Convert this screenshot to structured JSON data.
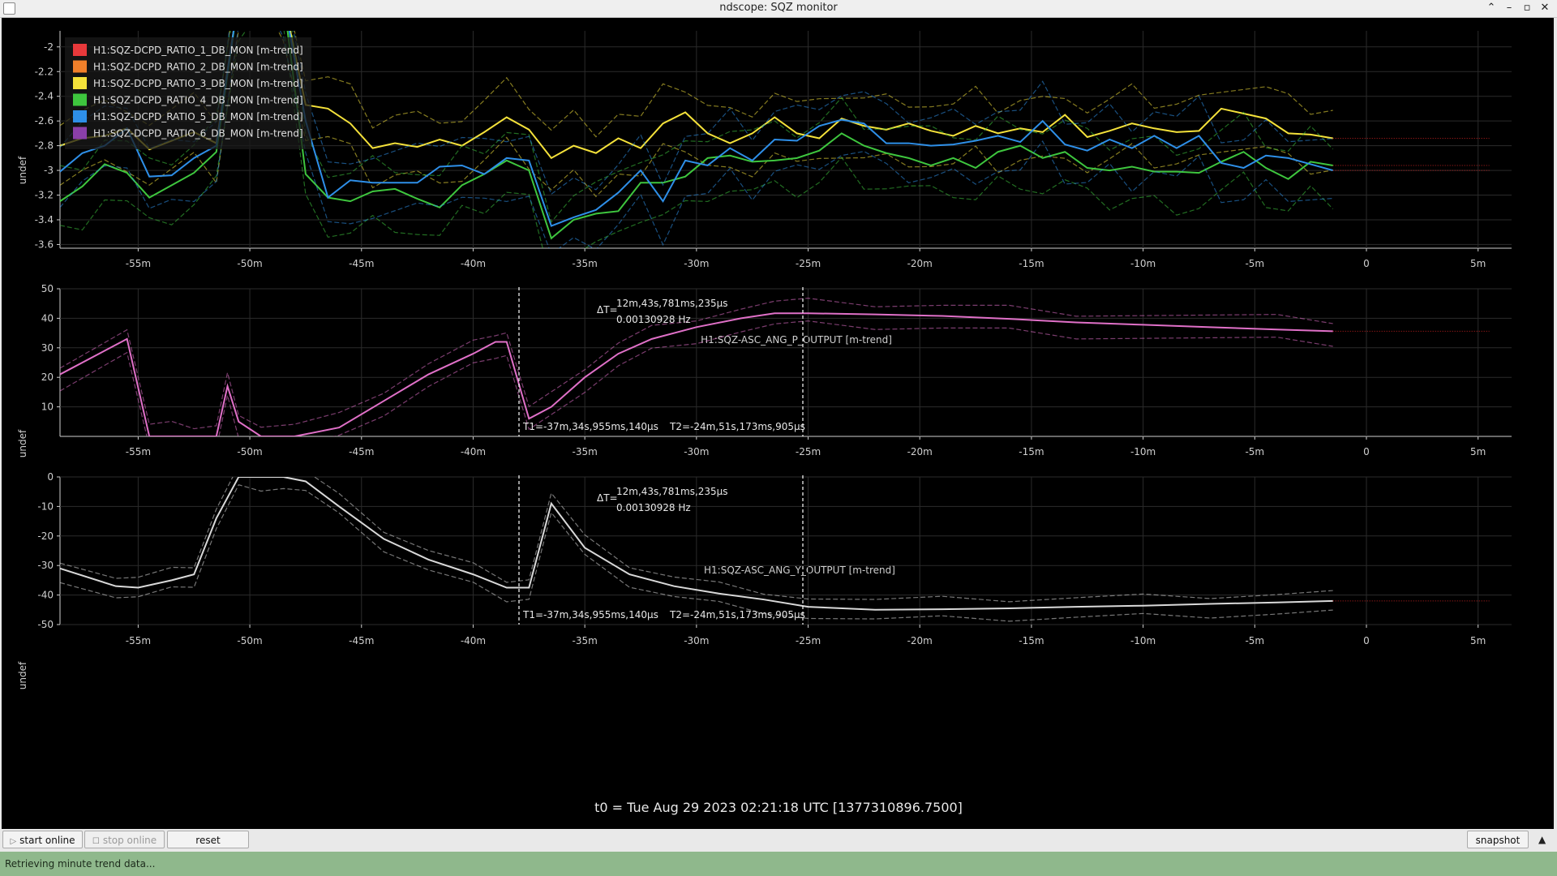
{
  "window": {
    "title": "ndscope: SQZ monitor"
  },
  "colors": {
    "background": "#000000",
    "grid": "#2b2b2b",
    "axis": "#cfcfcf",
    "cursor": "#ffffff",
    "status_bar": "#8fb88c"
  },
  "x_axis": {
    "ticks": [
      "-55m",
      "-50m",
      "-45m",
      "-40m",
      "-35m",
      "-30m",
      "-25m",
      "-20m",
      "-15m",
      "-10m",
      "-5m",
      "0",
      "5m"
    ]
  },
  "cursors": {
    "t1": "T1=-37m,34s,955ms,140μs",
    "t2": "T2=-24m,51s,173ms,905μs",
    "delta_label": "ΔT=",
    "delta": "12m,43s,781ms,235μs",
    "freq": "0.00130928 Hz"
  },
  "t0": "t0 = Tue Aug 29 2023 02:21:18 UTC [1377310896.7500]",
  "controls": {
    "start_online": "start online",
    "stop_online": "stop online",
    "reset": "reset",
    "snapshot": "snapshot"
  },
  "status": "Retrieving minute trend data...",
  "chart_data": [
    {
      "type": "line",
      "title": "",
      "ylabel": "undef",
      "xlabel": "",
      "x_unit": "minutes",
      "xlim": [
        -58.5,
        6.5
      ],
      "ylim": [
        -3.63,
        -1.87
      ],
      "yticks": [
        -2,
        -2.2,
        -2.4,
        -2.6,
        -2.8,
        -3,
        -3.2,
        -3.4,
        -3.6
      ],
      "grid": true,
      "legend_position": "top-left",
      "x": [
        -58.5,
        -57.5,
        -56.5,
        -55.5,
        -54.5,
        -53.5,
        -52.5,
        -51.5,
        -50.5,
        -49.5,
        -48.5,
        -47.5,
        -46.5,
        -45.5,
        -44.5,
        -43.5,
        -42.5,
        -41.5,
        -40.5,
        -39.5,
        -38.5,
        -37.5,
        -36.5,
        -35.5,
        -34.5,
        -33.5,
        -32.5,
        -31.5,
        -30.5,
        -29.5,
        -28.5,
        -27.5,
        -26.5,
        -25.5,
        -24.5,
        -23.5,
        -22.5,
        -21.5,
        -20.5,
        -19.5,
        -18.5,
        -17.5,
        -16.5,
        -15.5,
        -14.5,
        -13.5,
        -12.5,
        -11.5,
        -10.5,
        -9.5,
        -8.5,
        -7.5,
        -6.5,
        -5.5,
        -4.5,
        -3.5,
        -2.5,
        -1.5
      ],
      "series": [
        {
          "name": "H1:SQZ-DCPD_RATIO_1_DB_MON [m-trend]",
          "color": "#e8393b",
          "values": []
        },
        {
          "name": "H1:SQZ-DCPD_RATIO_2_DB_MON [m-trend]",
          "color": "#f07f2a",
          "values": []
        },
        {
          "name": "H1:SQZ-DCPD_RATIO_3_DB_MON [m-trend]",
          "color": "#f4e13a",
          "values": [
            -2.8,
            -2.74,
            -2.72,
            -2.66,
            -2.83,
            -2.76,
            -2.69,
            -2.78,
            -1.6,
            -1.4,
            -1.6,
            -2.47,
            -2.5,
            -2.62,
            -2.82,
            -2.78,
            -2.81,
            -2.75,
            -2.8,
            -2.69,
            -2.57,
            -2.67,
            -2.9,
            -2.8,
            -2.86,
            -2.74,
            -2.82,
            -2.62,
            -2.53,
            -2.7,
            -2.78,
            -2.7,
            -2.57,
            -2.7,
            -2.74,
            -2.58,
            -2.64,
            -2.67,
            -2.62,
            -2.68,
            -2.72,
            -2.64,
            -2.7,
            -2.66,
            -2.69,
            -2.55,
            -2.73,
            -2.68,
            -2.62,
            -2.66,
            -2.69,
            -2.68,
            -2.5,
            -2.54,
            -2.58,
            -2.7,
            -2.71,
            -2.74,
            -2.68,
            -2.58
          ]
        },
        {
          "name": "H1:SQZ-DCPD_RATIO_4_DB_MON [m-trend]",
          "color": "#3ec63e",
          "values": [
            -3.25,
            -3.13,
            -2.95,
            -3.02,
            -3.22,
            -3.12,
            -3.02,
            -2.85,
            -1.6,
            -1.4,
            -1.6,
            -3.03,
            -3.22,
            -3.25,
            -3.17,
            -3.15,
            -3.23,
            -3.3,
            -3.12,
            -3.03,
            -2.92,
            -3.0,
            -3.55,
            -3.4,
            -3.35,
            -3.33,
            -3.1,
            -3.1,
            -3.05,
            -2.9,
            -2.88,
            -2.93,
            -2.92,
            -2.9,
            -2.84,
            -2.7,
            -2.8,
            -2.86,
            -2.9,
            -2.96,
            -2.9,
            -2.98,
            -2.85,
            -2.8,
            -2.9,
            -2.85,
            -2.98,
            -3.0,
            -2.97,
            -3.01,
            -3.01,
            -3.02,
            -2.93,
            -2.85,
            -2.98,
            -3.07,
            -2.93,
            -2.96,
            -2.9,
            -2.85,
            -2.97
          ]
        },
        {
          "name": "H1:SQZ-DCPD_RATIO_5_DB_MON [m-trend]",
          "color": "#2e8fe8",
          "values": [
            -3.01,
            -2.86,
            -2.8,
            -2.66,
            -3.05,
            -3.04,
            -2.9,
            -2.8,
            -1.6,
            -1.4,
            -1.6,
            -2.6,
            -3.22,
            -3.08,
            -3.1,
            -3.1,
            -3.1,
            -2.97,
            -2.96,
            -3.03,
            -2.9,
            -2.92,
            -3.45,
            -3.38,
            -3.32,
            -3.18,
            -3.0,
            -3.25,
            -2.92,
            -2.96,
            -2.82,
            -2.92,
            -2.75,
            -2.76,
            -2.64,
            -2.59,
            -2.62,
            -2.78,
            -2.78,
            -2.8,
            -2.79,
            -2.76,
            -2.72,
            -2.77,
            -2.6,
            -2.79,
            -2.84,
            -2.75,
            -2.82,
            -2.72,
            -2.82,
            -2.72,
            -2.94,
            -2.98,
            -2.88,
            -2.9,
            -2.95,
            -3.0,
            -3.15,
            -2.98,
            -2.88
          ]
        },
        {
          "name": "H1:SQZ-DCPD_RATIO_6_DB_MON [m-trend]",
          "color": "#8a3fa8",
          "values": []
        }
      ]
    },
    {
      "type": "line",
      "title": "H1:SQZ-ASC_ANG_P_OUTPUT [m-trend]",
      "ylabel": "undef",
      "xlabel": "",
      "x_unit": "minutes",
      "xlim": [
        -58.5,
        6.5
      ],
      "ylim": [
        0,
        50
      ],
      "yticks": [
        10,
        20,
        30,
        40,
        50
      ],
      "grid": true,
      "x": [
        -58.5,
        -55.5,
        -54.5,
        -53.5,
        -52.5,
        -51.5,
        -51,
        -50.5,
        -49.5,
        -48,
        -46,
        -44,
        -42,
        -40,
        -39,
        -38.5,
        -37.5,
        -36.5,
        -35,
        -33.5,
        -32,
        -30,
        -28,
        -26.5,
        -25,
        -22,
        -19,
        -16,
        -13,
        -10,
        -7,
        -4,
        -1.5
      ],
      "series": [
        {
          "name": "",
          "color": "#e070c8",
          "values": [
            21,
            33,
            0,
            0,
            0,
            0,
            17,
            5,
            0,
            0,
            3,
            12,
            21,
            28,
            32,
            32,
            6,
            10,
            20,
            28,
            33,
            37,
            40,
            41.7,
            41.7,
            41.3,
            40.8,
            39.8,
            38.6,
            37.8,
            37.0,
            36.2,
            35.6
          ]
        }
      ]
    },
    {
      "type": "line",
      "title": "H1:SQZ-ASC_ANG_Y_OUTPUT [m-trend]",
      "ylabel": "undef",
      "xlabel": "",
      "x_unit": "minutes",
      "xlim": [
        -58.5,
        6.5
      ],
      "ylim": [
        -50,
        0
      ],
      "yticks": [
        0,
        -10,
        -20,
        -30,
        -40,
        -50
      ],
      "grid": true,
      "x": [
        -58.5,
        -56,
        -55,
        -53.5,
        -52.5,
        -51.5,
        -50.5,
        -49.5,
        -48.5,
        -47.5,
        -46,
        -44,
        -42,
        -40,
        -38.5,
        -37.5,
        -36.5,
        -35,
        -33,
        -31,
        -29,
        -27,
        -25,
        -22,
        -19,
        -16,
        -13,
        -10,
        -7,
        -4,
        -1.5
      ],
      "series": [
        {
          "name": "",
          "color": "#d9d9d9",
          "values": [
            -31,
            -37,
            -37.5,
            -35,
            -33,
            -14,
            0,
            0,
            0,
            -1.5,
            -10,
            -21,
            -28,
            -33,
            -37.5,
            -37.5,
            -9,
            -24,
            -33,
            -37,
            -39.5,
            -41.5,
            -44,
            -45,
            -44.8,
            -44.5,
            -44,
            -43.6,
            -43,
            -42.5,
            -42
          ]
        }
      ]
    }
  ]
}
